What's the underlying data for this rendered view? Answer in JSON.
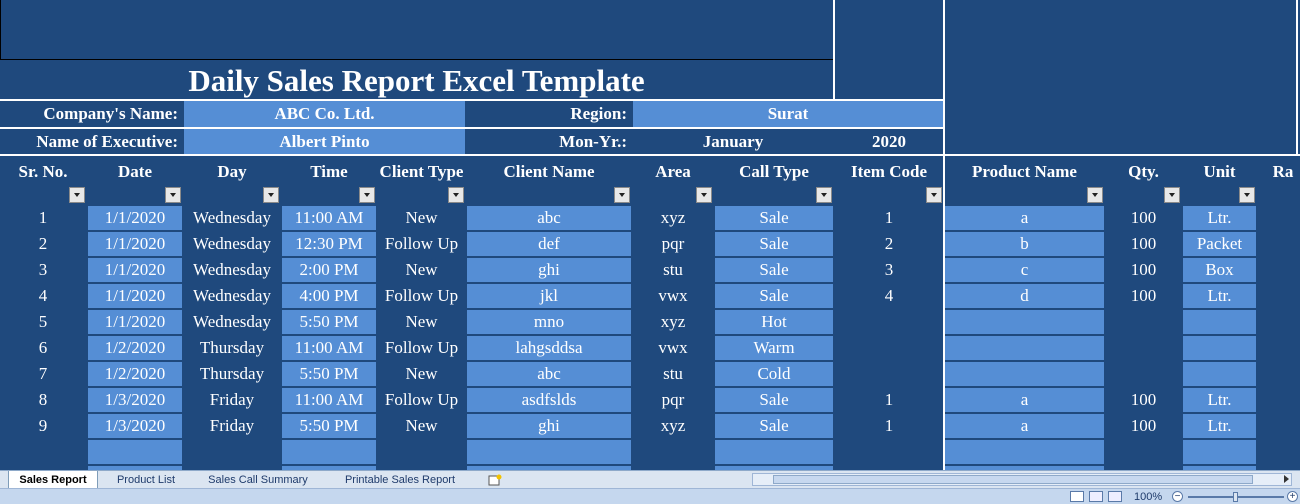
{
  "title": "Daily Sales Report Excel Template",
  "info": {
    "company_label": "Company's Name:",
    "company_value": "ABC Co. Ltd.",
    "region_label": "Region:",
    "region_value": "Surat",
    "executive_label": "Name of Executive:",
    "executive_value": "Albert Pinto",
    "monyr_label": "Mon-Yr.:",
    "month_value": "January",
    "year_value": "2020"
  },
  "headers": [
    "Sr. No.",
    "Date",
    "Day",
    "Time",
    "Client Type",
    "Client Name",
    "Area",
    "Call Type",
    "Item Code",
    "Product Name",
    "Qty.",
    "Unit",
    "Ra"
  ],
  "rows": [
    [
      "1",
      "1/1/2020",
      "Wednesday",
      "11:00 AM",
      "New",
      "abc",
      "xyz",
      "Sale",
      "1",
      "a",
      "100",
      "Ltr.",
      ""
    ],
    [
      "2",
      "1/1/2020",
      "Wednesday",
      "12:30 PM",
      "Follow Up",
      "def",
      "pqr",
      "Sale",
      "2",
      "b",
      "100",
      "Packet",
      ""
    ],
    [
      "3",
      "1/1/2020",
      "Wednesday",
      "2:00 PM",
      "New",
      "ghi",
      "stu",
      "Sale",
      "3",
      "c",
      "100",
      "Box",
      ""
    ],
    [
      "4",
      "1/1/2020",
      "Wednesday",
      "4:00 PM",
      "Follow Up",
      "jkl",
      "vwx",
      "Sale",
      "4",
      "d",
      "100",
      "Ltr.",
      ""
    ],
    [
      "5",
      "1/1/2020",
      "Wednesday",
      "5:50 PM",
      "New",
      "mno",
      "xyz",
      "Hot",
      "",
      "",
      "",
      "",
      ""
    ],
    [
      "6",
      "1/2/2020",
      "Thursday",
      "11:00 AM",
      "Follow Up",
      "lahgsddsa",
      "vwx",
      "Warm",
      "",
      "",
      "",
      "",
      ""
    ],
    [
      "7",
      "1/2/2020",
      "Thursday",
      "5:50 PM",
      "New",
      "abc",
      "stu",
      "Cold",
      "",
      "",
      "",
      "",
      ""
    ],
    [
      "8",
      "1/3/2020",
      "Friday",
      "11:00 AM",
      "Follow Up",
      "asdfslds",
      "pqr",
      "Sale",
      "1",
      "a",
      "100",
      "Ltr.",
      ""
    ],
    [
      "9",
      "1/3/2020",
      "Friday",
      "5:50 PM",
      "New",
      "ghi",
      "xyz",
      "Sale",
      "1",
      "a",
      "100",
      "Ltr.",
      ""
    ]
  ],
  "sheet_tabs": [
    "Sales Report",
    "Product List",
    "Sales Call Summary",
    "Printable Sales Report"
  ],
  "zoom": "100%",
  "colors": {
    "dark": "#1f497d",
    "light": "#558ed5",
    "text": "#ffffff"
  }
}
